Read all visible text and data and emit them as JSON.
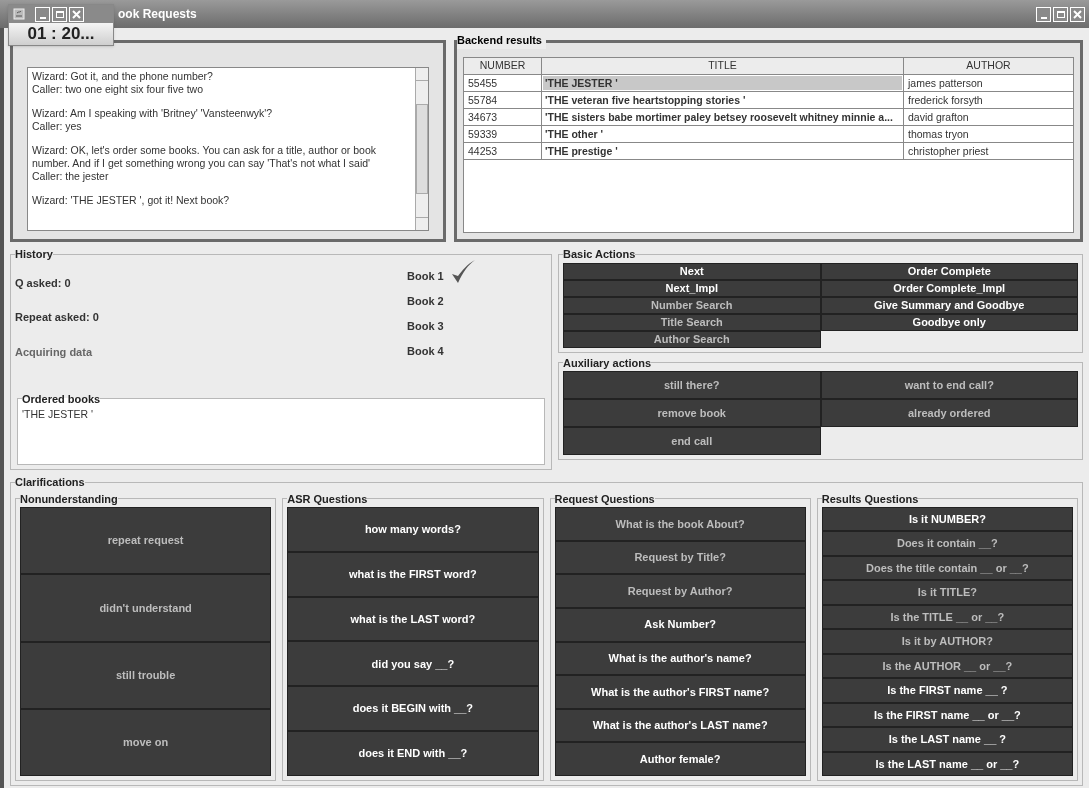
{
  "window": {
    "title": "ook Requests"
  },
  "timer": {
    "value": "01 : 20..."
  },
  "transcript": [
    {
      "lines": [
        "Wizard: Got it, and the phone number?",
        "Caller: two one eight six four five two"
      ]
    },
    {
      "lines": [
        "Wizard: Am I speaking with  'Britney' 'Vansteenwyk'?",
        "Caller: yes"
      ]
    },
    {
      "lines": [
        "Wizard: OK, let's order some books. You can ask for a title, author or book number. And if I get something wrong you can say 'That's not what I said'",
        "Caller: the jester"
      ]
    },
    {
      "lines": [
        "Wizard: 'THE JESTER ', got it! Next book?"
      ]
    }
  ],
  "backend_results": {
    "title": "Backend results",
    "columns": [
      "NUMBER",
      "TITLE",
      "AUTHOR"
    ],
    "rows": [
      {
        "number": "55455",
        "title": "'THE JESTER '",
        "author": "james patterson",
        "selected": true
      },
      {
        "number": "55784",
        "title": "'THE veteran five heartstopping stories '",
        "author": "frederick forsyth",
        "selected": false
      },
      {
        "number": "34673",
        "title": "'THE sisters babe mortimer paley betsey roosevelt whitney minnie a...",
        "author": "david grafton",
        "selected": false
      },
      {
        "number": "59339",
        "title": "'THE other '",
        "author": "thomas tryon",
        "selected": false
      },
      {
        "number": "44253",
        "title": "'THE prestige '",
        "author": "christopher priest",
        "selected": false
      }
    ]
  },
  "history": {
    "title": "History",
    "q_asked": "Q asked:   0",
    "repeat_asked": "Repeat asked:   0",
    "status": "Acquiring data",
    "books": [
      {
        "label": "Book 1",
        "checked": true
      },
      {
        "label": "Book 2",
        "checked": false
      },
      {
        "label": "Book 3",
        "checked": false
      },
      {
        "label": "Book 4",
        "checked": false
      }
    ],
    "ordered_books": {
      "title": "Ordered books",
      "items": [
        "'THE JESTER '"
      ]
    }
  },
  "basic_actions": {
    "title": "Basic Actions",
    "buttons": [
      {
        "label": "Next",
        "disabled": false
      },
      {
        "label": "Order Complete",
        "disabled": false
      },
      {
        "label": "Next_Impl",
        "disabled": false
      },
      {
        "label": "Order Complete_Impl",
        "disabled": false
      },
      {
        "label": "Number Search",
        "disabled": true
      },
      {
        "label": "Give Summary and Goodbye",
        "disabled": false
      },
      {
        "label": "Title Search",
        "disabled": true
      },
      {
        "label": "Goodbye only",
        "disabled": false
      },
      {
        "label": "Author Search",
        "disabled": true
      }
    ]
  },
  "auxiliary_actions": {
    "title": "Auxiliary actions",
    "buttons": [
      {
        "label": "still there?",
        "disabled": true
      },
      {
        "label": "want to end call?",
        "disabled": true
      },
      {
        "label": "remove book",
        "disabled": true
      },
      {
        "label": "already ordered",
        "disabled": true
      },
      {
        "label": "end call",
        "disabled": true
      }
    ]
  },
  "clarifications": {
    "title": "Clarifications",
    "groups": [
      {
        "title": "Nonunderstanding",
        "buttons": [
          {
            "label": "repeat request",
            "disabled": true
          },
          {
            "label": "didn't understand",
            "disabled": true
          },
          {
            "label": "still trouble",
            "disabled": true
          },
          {
            "label": "move on",
            "disabled": true
          }
        ]
      },
      {
        "title": "ASR Questions",
        "buttons": [
          {
            "label": "how many words?",
            "disabled": false
          },
          {
            "label": "what is the FIRST word?",
            "disabled": false
          },
          {
            "label": "what is the LAST word?",
            "disabled": false
          },
          {
            "label": "did you say __?",
            "disabled": false
          },
          {
            "label": "does it BEGIN with __?",
            "disabled": false
          },
          {
            "label": "does it END with __?",
            "disabled": false
          }
        ]
      },
      {
        "title": "Request Questions",
        "buttons": [
          {
            "label": "What is the book About?",
            "disabled": true
          },
          {
            "label": "Request by Title?",
            "disabled": true
          },
          {
            "label": "Request by Author?",
            "disabled": true
          },
          {
            "label": "Ask Number?",
            "disabled": false
          },
          {
            "label": "What is the author's name?",
            "disabled": false
          },
          {
            "label": "What is the author's FIRST name?",
            "disabled": false
          },
          {
            "label": "What is the author's LAST name?",
            "disabled": false
          },
          {
            "label": "Author female?",
            "disabled": false
          }
        ]
      },
      {
        "title": "Results Questions",
        "buttons": [
          {
            "label": "Is it NUMBER?",
            "disabled": false
          },
          {
            "label": "Does it contain __?",
            "disabled": true
          },
          {
            "label": "Does the title contain __ or __?",
            "disabled": true
          },
          {
            "label": "Is it TITLE?",
            "disabled": true
          },
          {
            "label": "Is the TITLE __ or __?",
            "disabled": true
          },
          {
            "label": "Is it by AUTHOR?",
            "disabled": true
          },
          {
            "label": "Is the AUTHOR __ or __?",
            "disabled": true
          },
          {
            "label": "Is the FIRST name __ ?",
            "disabled": false
          },
          {
            "label": "Is the FIRST name __ or __?",
            "disabled": false
          },
          {
            "label": "Is the LAST name __ ?",
            "disabled": false
          },
          {
            "label": "Is the LAST name __ or __?",
            "disabled": false
          }
        ]
      }
    ]
  }
}
